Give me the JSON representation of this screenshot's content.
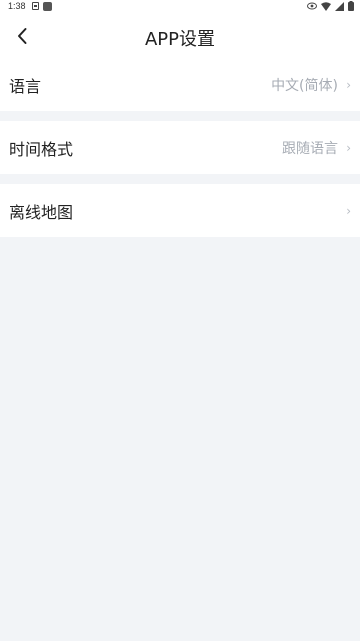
{
  "status_bar": {
    "time": "1:38"
  },
  "header": {
    "title": "APP设置"
  },
  "settings": {
    "items": [
      {
        "label": "语言",
        "value": "中文(简体)",
        "chevron": "›"
      },
      {
        "label": "时间格式",
        "value": "跟随语言",
        "chevron": "›"
      },
      {
        "label": "离线地图",
        "value": "",
        "chevron": "›"
      }
    ]
  },
  "colors": {
    "background": "#f2f4f7",
    "card": "#ffffff",
    "text_primary": "#222222",
    "text_secondary": "#a7acb4"
  },
  "icons": {
    "back": "chevron-left-icon",
    "status": [
      "notification-icon",
      "app-icon",
      "eye-icon",
      "wifi-icon",
      "signal-icon",
      "battery-icon"
    ]
  }
}
